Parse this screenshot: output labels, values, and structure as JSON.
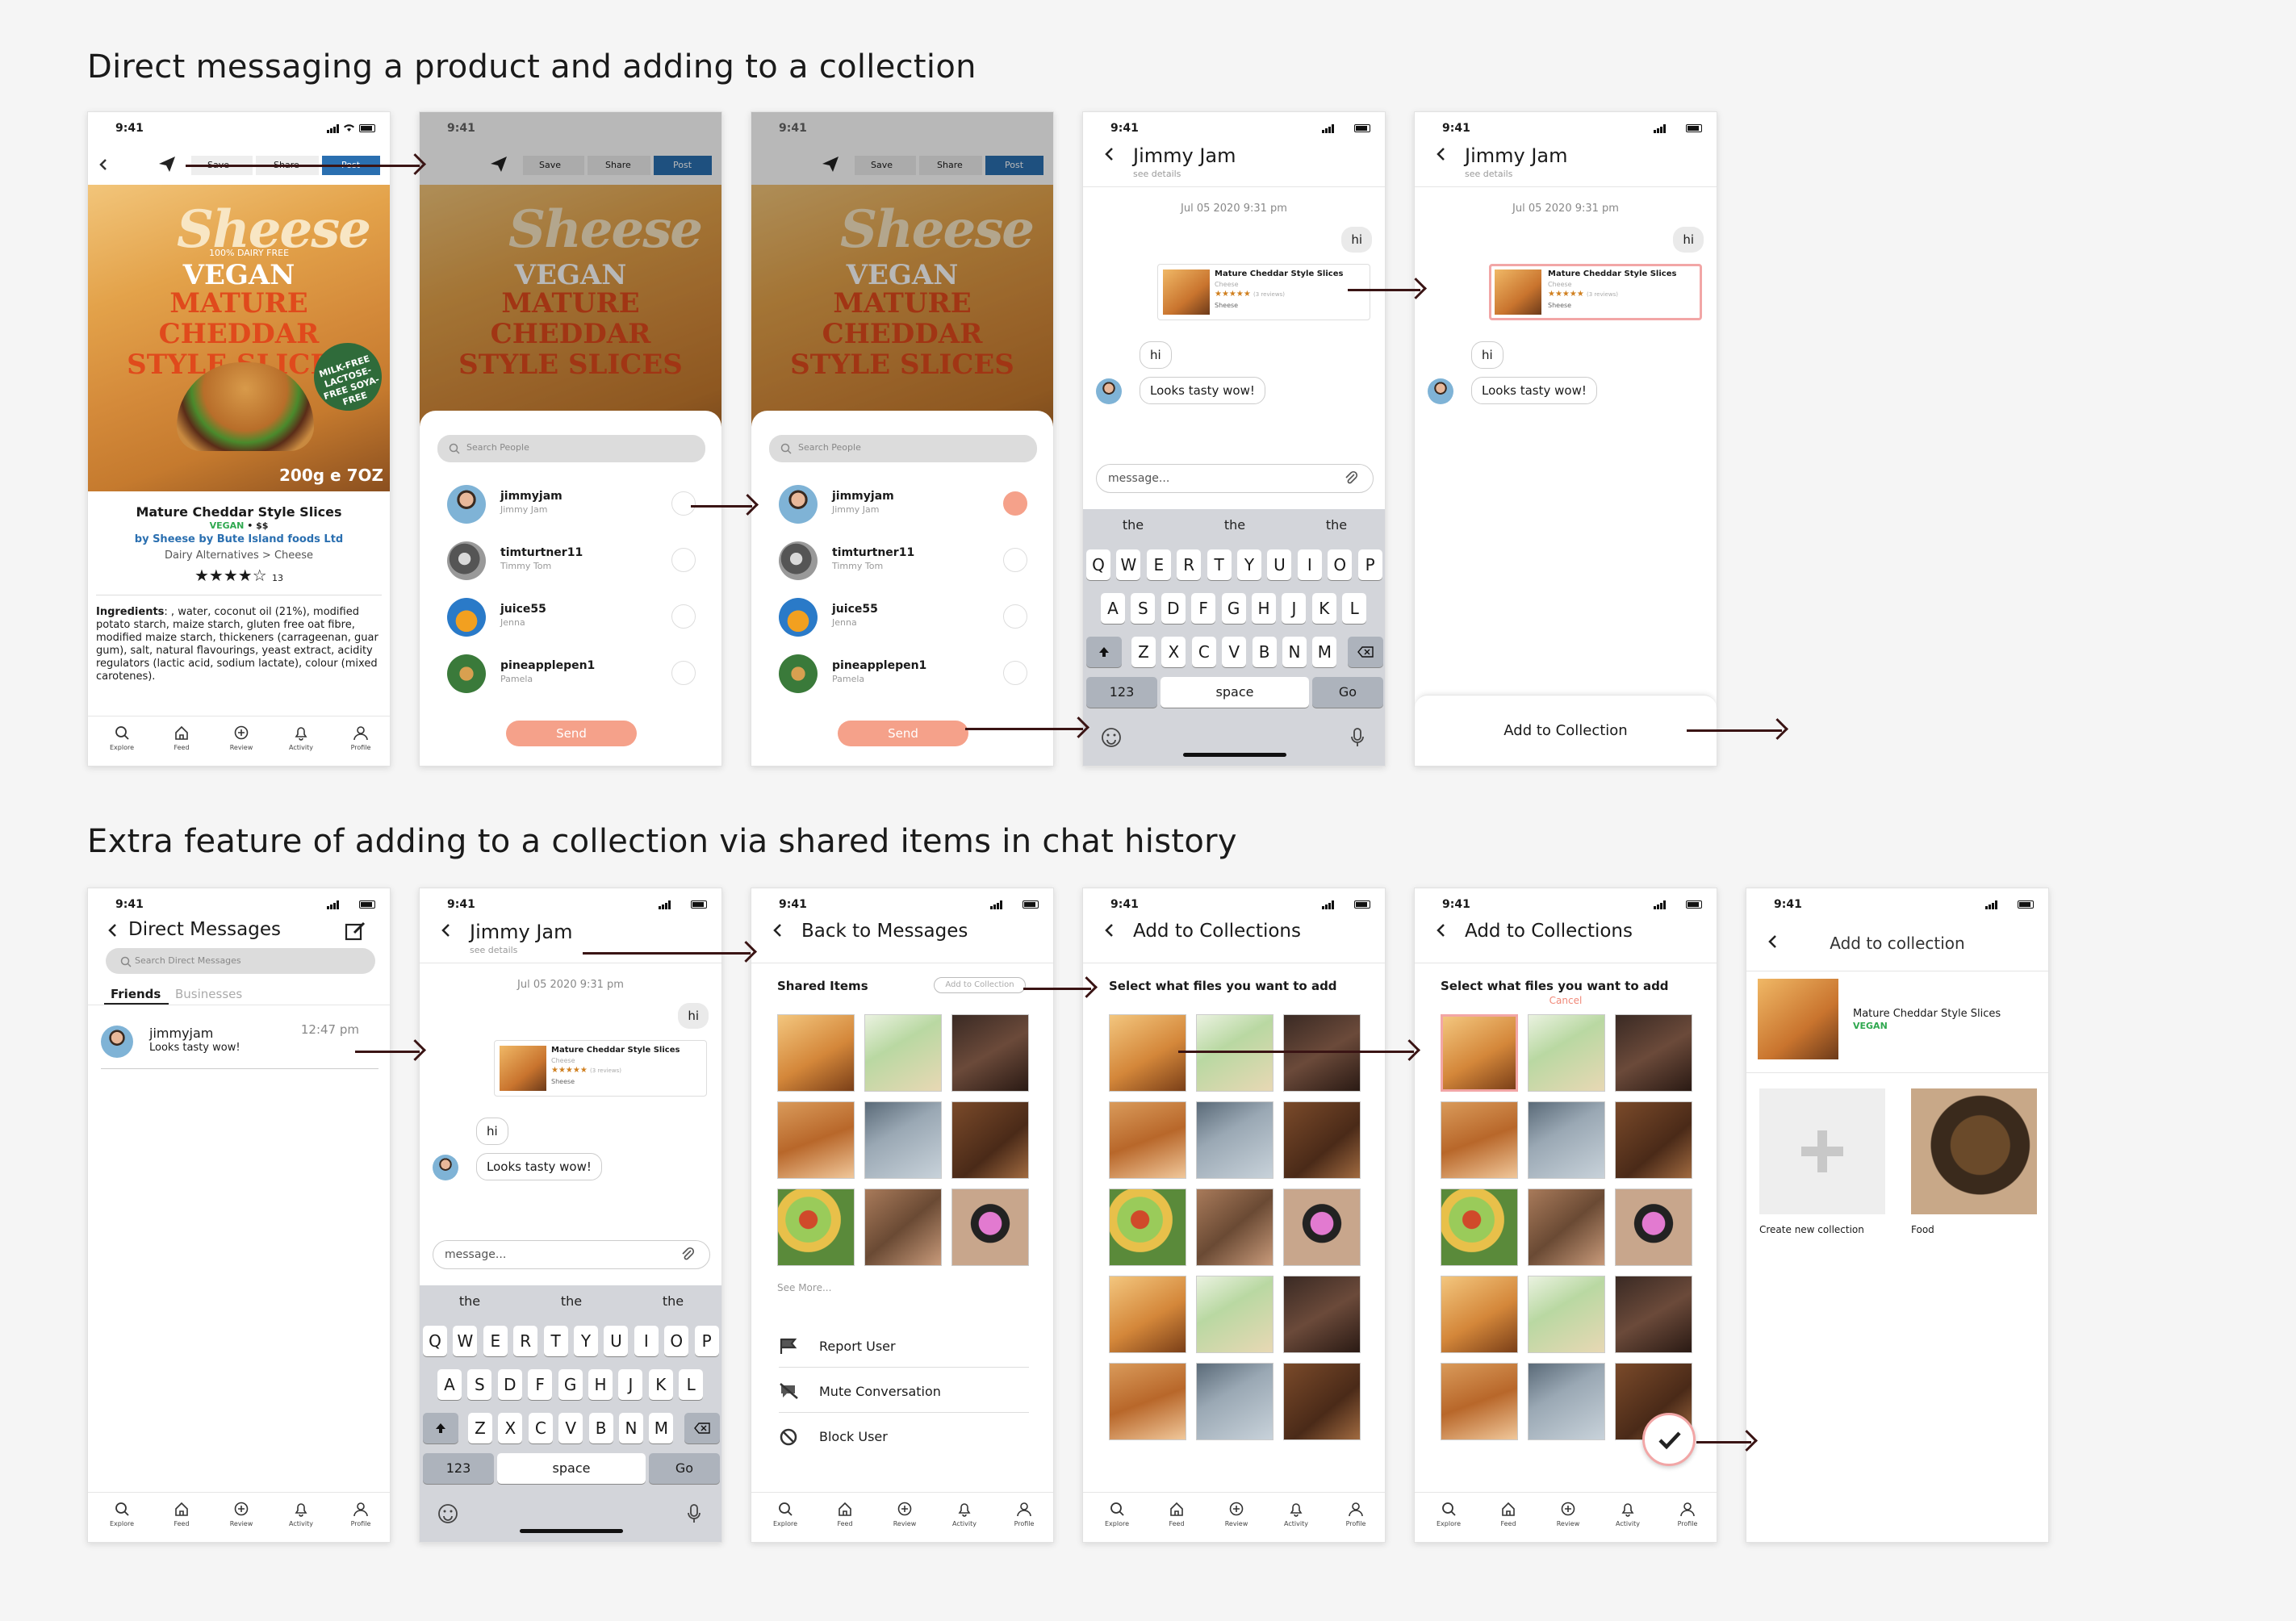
{
  "section1_title": "Direct messaging a product and adding to a collection",
  "section2_title": "Extra feature of adding to a collection via shared items in chat history",
  "time": "9:41",
  "nav": [
    "Explore",
    "Feed",
    "Review",
    "Activity",
    "Profile"
  ],
  "product": {
    "toolbar": [
      "Save",
      "Share",
      "Post"
    ],
    "brand_logo": "Sheese",
    "brand_sub": "100% DAIRY FREE",
    "pack_line1": "VEGAN",
    "pack_line2": "MATURE CHEDDAR STYLE SLICES",
    "pack_badge": "MILK-FREE LACTOSE-FREE SOYA-FREE",
    "pack_weight": "200g e 7OZ",
    "name": "Mature Cheddar Style Slices",
    "vegan": "VEGAN",
    "price": " • $$",
    "by": "by Sheese by Bute Island foods Ltd",
    "category": "Dairy Alternatives",
    "subcategory": "Cheese",
    "stars": "★★★★☆",
    "review_count": "13",
    "ingredients_label": "Ingredients",
    "ingredients": ": , water, coconut oil (21%), modified potato starch, maize starch, gluten free oat fibre, modified maize starch, thickeners (carrageenan, guar gum), salt, natural flavourings, yeast extract, acidity regulators (lactic acid, sodium lactate), colour (mixed carotenes)."
  },
  "share": {
    "search_placeholder": "Search People",
    "people": [
      {
        "name": "jimmyjam",
        "sub": "Jimmy Jam"
      },
      {
        "name": "timturtner11",
        "sub": "Timmy Tom"
      },
      {
        "name": "juice55",
        "sub": "Jenna"
      },
      {
        "name": "pineapplepen1",
        "sub": "Pamela"
      }
    ],
    "send": "Send"
  },
  "chat": {
    "title": "Jimmy Jam",
    "see_details": "see details",
    "date": "Jul 05 2020 9:31 pm",
    "msg_hi": "hi",
    "card_title": "Mature Cheddar Style Slices",
    "card_cat": "Cheese",
    "card_stars": "★★★★★",
    "card_reviews": "(3 reviews)",
    "card_brand": "Sheese",
    "reply_hi": "hi",
    "reply": "Looks tasty wow!",
    "input_placeholder": "message...",
    "suggestions": [
      "the",
      "the",
      "the"
    ],
    "row1": [
      "Q",
      "W",
      "E",
      "R",
      "T",
      "Y",
      "U",
      "I",
      "O",
      "P"
    ],
    "row2": [
      "A",
      "S",
      "D",
      "F",
      "G",
      "H",
      "J",
      "K",
      "L"
    ],
    "row3": [
      "Z",
      "X",
      "C",
      "V",
      "B",
      "N",
      "M"
    ],
    "k123": "123",
    "space": "space",
    "go": "Go",
    "add_to_collection": "Add to Collection"
  },
  "dm": {
    "title": "Direct Messages",
    "search_placeholder": "Search Direct Messages",
    "tab_friends": "Friends",
    "tab_businesses": "Businesses",
    "thread_name": "jimmyjam",
    "thread_preview": "Looks tasty wow!",
    "thread_time": "12:47 pm"
  },
  "shared": {
    "back": "Back to Messages",
    "shared_items": "Shared Items",
    "add_btn": "Add to Collection",
    "see_more": "See More...",
    "report": "Report User",
    "mute": "Mute Conversation",
    "block": "Block User"
  },
  "collections": {
    "title": "Add to Collections",
    "subtitle": "Select what files you want to add",
    "cancel": "Cancel"
  },
  "final": {
    "title": "Add to collection",
    "product": "Mature Cheddar Style Slices",
    "vegan": "VEGAN",
    "create": "Create new collection",
    "food": "Food"
  },
  "colors": {
    "accent": "#f5a18a",
    "brand_blue": "#2a6fb0",
    "vegan_green": "#2fa84f",
    "arrow": "#3a1414"
  }
}
